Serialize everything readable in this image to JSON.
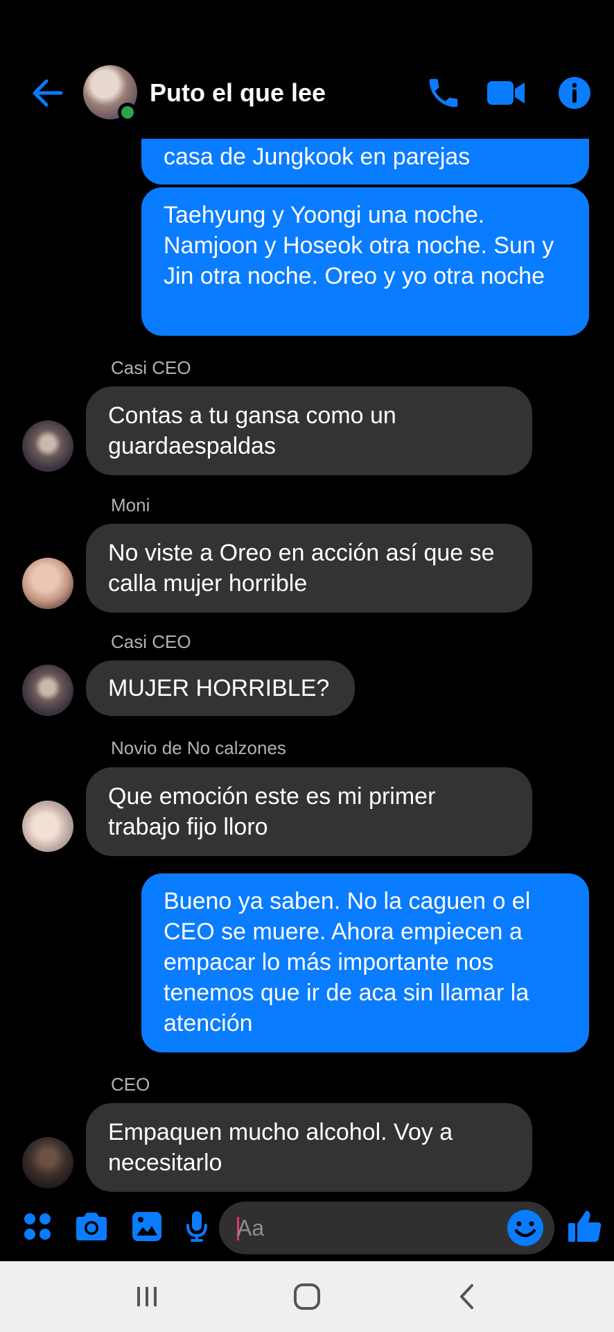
{
  "header": {
    "title": "Puto el que lee",
    "back_icon": "arrow-left-icon",
    "call_icon": "phone-icon",
    "video_icon": "video-camera-icon",
    "info_icon": "info-icon",
    "accent_color": "#0a7cff"
  },
  "messages": [
    {
      "type": "outgoing",
      "text": "casa de Jungkook en parejas"
    },
    {
      "type": "outgoing",
      "text": "Taehyung y Yoongi una noche. Namjoon y Hoseok otra noche. Sun y Jin otra noche. Oreo y yo otra noche"
    },
    {
      "type": "incoming",
      "sender": "Casi CEO",
      "text": "Contas a tu gansa como un guardaespaldas"
    },
    {
      "type": "incoming",
      "sender": "Moni",
      "text": "No viste a Oreo en acción así que se calla mujer horrible"
    },
    {
      "type": "incoming",
      "sender": "Casi CEO",
      "text": "MUJER HORRIBLE?"
    },
    {
      "type": "incoming",
      "sender": "Novio de No calzones",
      "text": "Que emoción este es mi primer trabajo fijo lloro"
    },
    {
      "type": "outgoing",
      "text": "Bueno ya saben. No la caguen o el CEO se muere. Ahora empiecen a empacar lo más importante nos tenemos que ir de aca sin llamar la atención"
    },
    {
      "type": "incoming",
      "sender": "CEO",
      "text": "Empaquen mucho alcohol. Voy a necesitarlo"
    }
  ],
  "composer": {
    "placeholder": "Aa",
    "icons": [
      "menu-dots-icon",
      "camera-icon",
      "gallery-icon",
      "microphone-icon",
      "emoji-icon",
      "thumbs-up-icon"
    ]
  },
  "navbar": {
    "icons": [
      "recent-apps-icon",
      "home-icon",
      "back-icon"
    ]
  }
}
